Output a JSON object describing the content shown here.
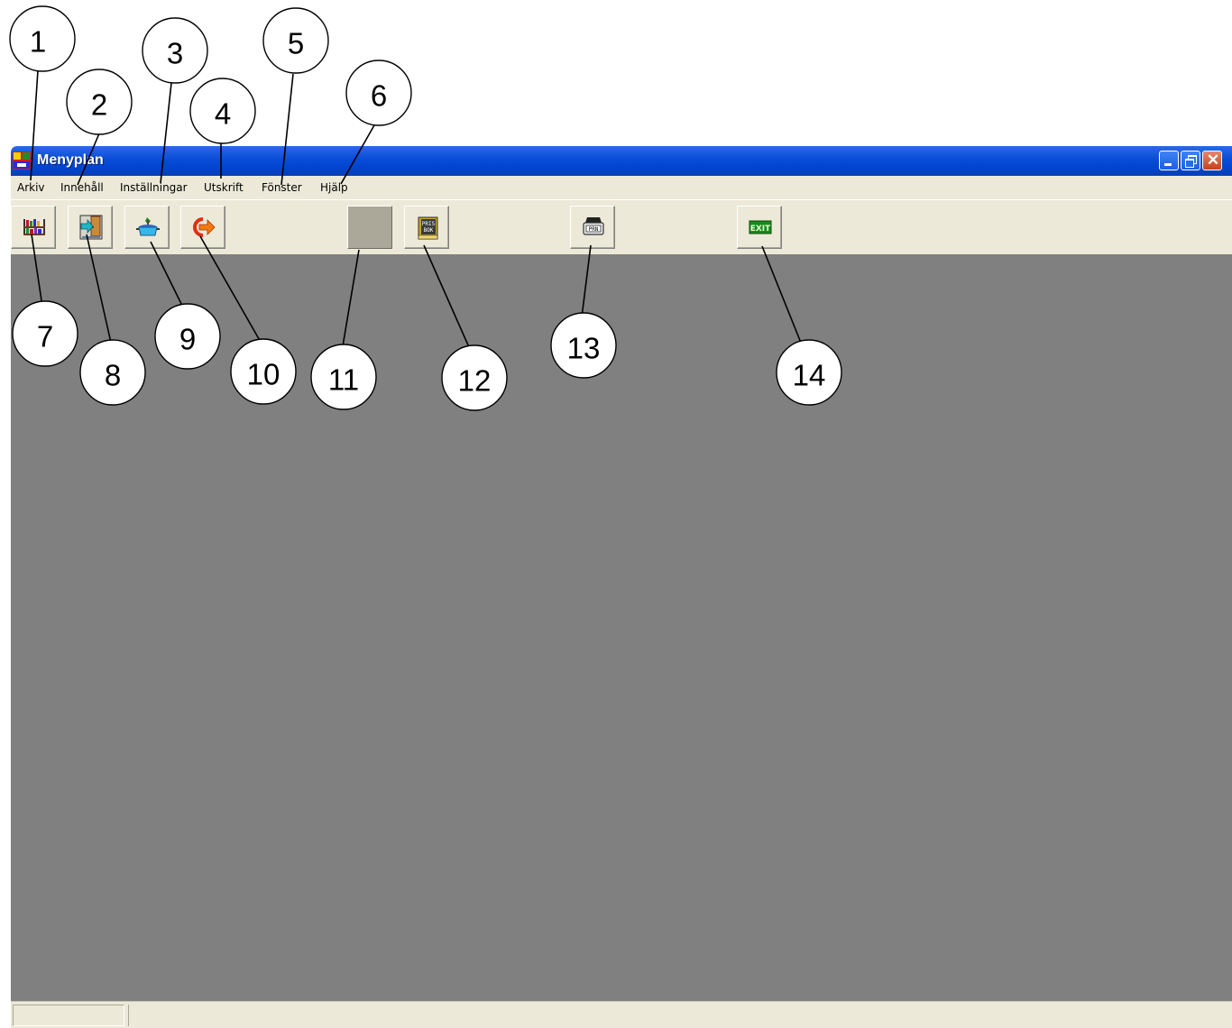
{
  "window": {
    "title": "Menyplan",
    "controls": [
      "minimize-icon",
      "restore-icon",
      "close-icon"
    ]
  },
  "menu": {
    "items": [
      "Arkiv",
      "Innehåll",
      "Inställningar",
      "Utskrift",
      "Fönster",
      "Hjälp"
    ]
  },
  "toolbar": {
    "buttons": [
      {
        "icon": "bookshelf-icon"
      },
      {
        "icon": "enter-door-icon"
      },
      {
        "icon": "cooking-pot-icon"
      },
      {
        "icon": "exit-arrow-icon"
      },
      {
        "icon": "blank-button"
      },
      {
        "icon": "price-book-icon",
        "label_lines": [
          "PRIS",
          "BOK"
        ]
      },
      {
        "icon": "printer-icon",
        "label": "PRN"
      },
      {
        "icon": "exit-sign-icon",
        "label": "EXIT"
      }
    ]
  },
  "callouts": [
    "1",
    "2",
    "3",
    "4",
    "5",
    "6",
    "7",
    "8",
    "9",
    "10",
    "11",
    "12",
    "13",
    "14"
  ],
  "colors": {
    "titlebar": "#0a4cd6",
    "menubar": "#ece9d8",
    "client": "#808080",
    "close_button": "#c7401c"
  }
}
